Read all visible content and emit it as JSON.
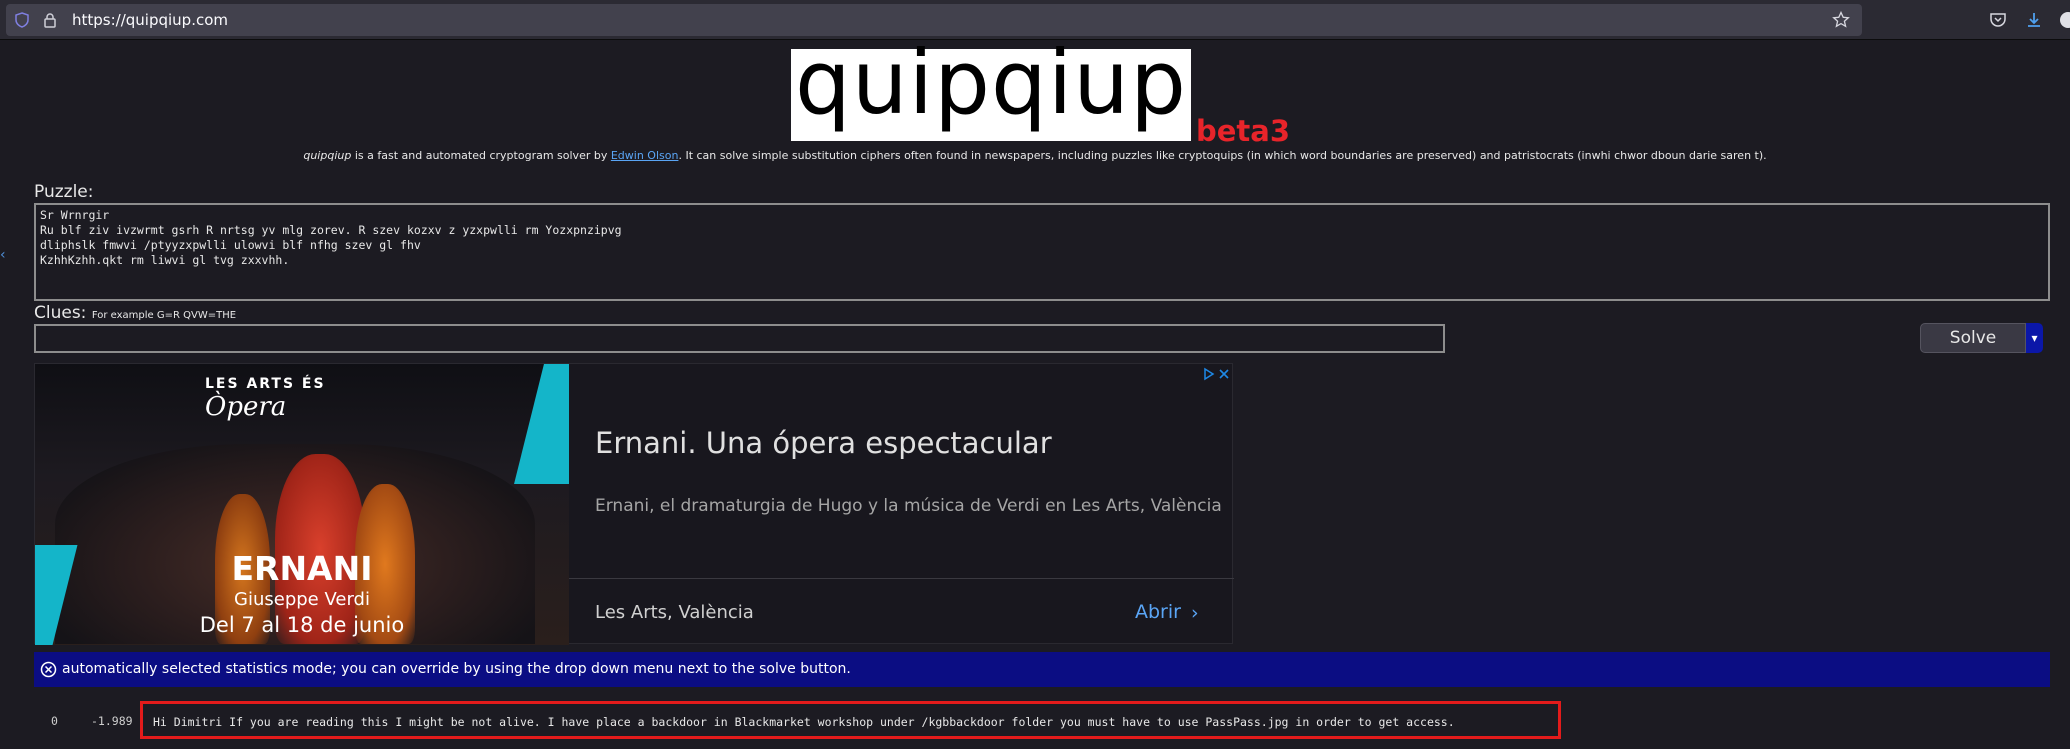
{
  "browser": {
    "url": "https://quipqiup.com"
  },
  "header": {
    "logo": "quipqiup",
    "beta": "beta3",
    "description_em": "quipqiup",
    "description_pre": " is a fast and automated cryptogram solver by ",
    "author_link": "Edwin Olson",
    "description_post": ". It can solve simple substitution ciphers often found in newspapers, including puzzles like cryptoquips (in which word boundaries are preserved) and patristocrats (inwhi chwor dboun darie saren t)."
  },
  "puzzle": {
    "label": "Puzzle:",
    "lines": [
      "Sr Wrnrgir",
      "Ru blf ziv ivzwrmt gsrh R nrtsg yv mlg zorev. R szev kozxv z yzxpwlli rm Yozxpnzipvg",
      "dliphslk fmwvi /ptyyzxpwlli ulowvi blf nfhg szev gl fhv",
      "KzhhKzhh.qkt rm liwvi gl tvg zxxvhh."
    ]
  },
  "clues": {
    "label": "Clues:",
    "hint": "For example G=R QVW=THE",
    "value": ""
  },
  "solve": {
    "label": "Solve",
    "dropdown": "▾"
  },
  "ad": {
    "brand": "LES ARTS ÉS",
    "brand_script": "Òpera",
    "image_title": "ERNANI",
    "image_composer": "Giuseppe Verdi",
    "image_dates": "Del 7 al 18 de junio",
    "title": "Ernani. Una ópera espectacular",
    "body": "Ernani, el dramaturgia de Hugo y la música de Verdi en Les Arts, València",
    "venue": "Les Arts, València",
    "cta": "Abrir"
  },
  "notice": {
    "text": "automatically selected statistics mode; you can override by using the drop down menu next to the solve button."
  },
  "results": [
    {
      "index": "0",
      "score": "-1.989",
      "text": "Hi Dimitri If you are reading this I might be not alive. I have place a backdoor in Blackmarket workshop under /kgbbackdoor folder you must have to use PassPass.jpg in order to get access."
    }
  ],
  "colors": {
    "beta": "#e8242a",
    "notice_bg": "#0b0d83",
    "highlight_border": "#e31b1b",
    "link": "#5aa5f5"
  }
}
